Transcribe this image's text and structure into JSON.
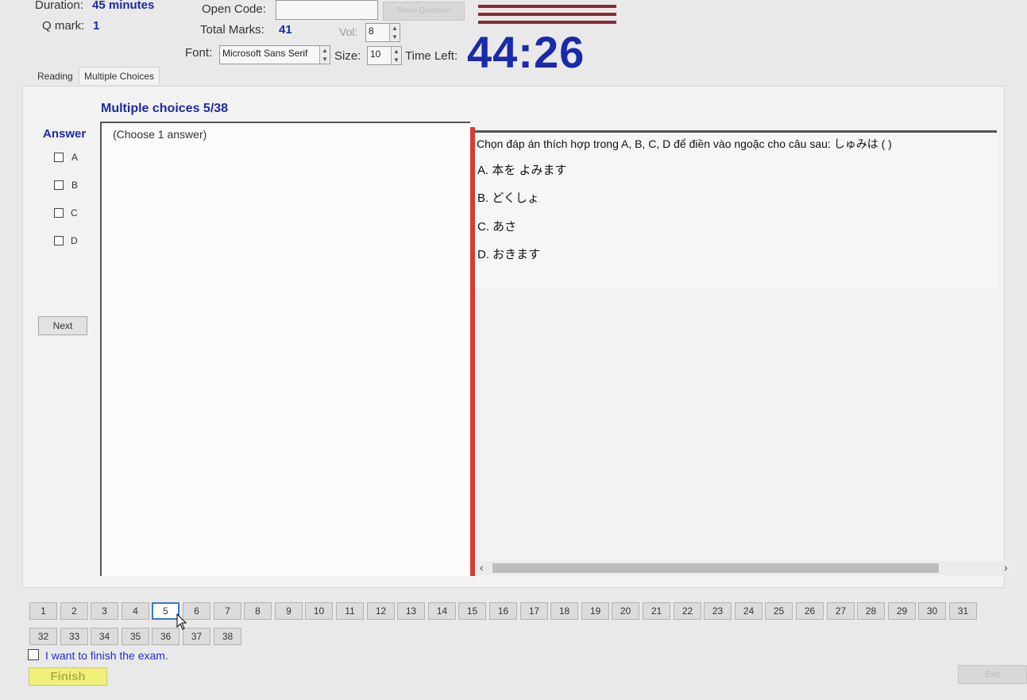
{
  "header": {
    "duration_label": "Duration:",
    "duration_value": "45 minutes",
    "qmark_label": "Q mark:",
    "qmark_value": "1",
    "open_code_label": "Open Code:",
    "open_code_value": "",
    "show_question_label": "Show Question",
    "total_marks_label": "Total Marks:",
    "total_marks_value": "41",
    "vol_label": "Vol:",
    "vol_value": "8",
    "font_label": "Font:",
    "font_value": "Microsoft Sans Serif",
    "size_label": "Size:",
    "size_value": "10",
    "time_left_label": "Time Left:",
    "time_left_value": "44:26"
  },
  "tabs": [
    {
      "label": "Reading",
      "active": false
    },
    {
      "label": "Multiple Choices",
      "active": true
    }
  ],
  "question_header": "Multiple choices 5/38",
  "answer": {
    "title": "Answer",
    "options": [
      "A",
      "B",
      "C",
      "D"
    ],
    "next_label": "Next"
  },
  "instruction": "(Choose 1 answer)",
  "question": {
    "prompt": "Chọn đáp án thích hợp trong A, B, C, D để điền vào ngoặc cho câu sau:  しゅみは (          )",
    "choices": [
      "A. 本を  よみます",
      "B. どくしょ",
      "C. あさ",
      "D. おきます"
    ]
  },
  "navigator": {
    "row1": [
      "1",
      "2",
      "3",
      "4",
      "5",
      "6",
      "7",
      "8",
      "9",
      "10",
      "11",
      "12",
      "13",
      "14",
      "15",
      "16",
      "17",
      "18",
      "19",
      "20",
      "21",
      "22",
      "23",
      "24",
      "25",
      "26",
      "27",
      "28",
      "29",
      "30",
      "31"
    ],
    "row2": [
      "32",
      "33",
      "34",
      "35",
      "36",
      "37",
      "38"
    ],
    "current": "5"
  },
  "footer": {
    "finish_checkbox_label": "I want to finish the exam.",
    "finish_label": "Finish",
    "exit_label": "Exit"
  },
  "colors": {
    "timer": "#1a2aa8",
    "accent_red": "#d93a32",
    "finish_yellow": "#f1f07a",
    "link_blue": "#2a2ad0"
  },
  "icons": {
    "mouse_cursor": "arrow-cursor-icon",
    "scroll_left": "chevron-left-icon",
    "scroll_right": "chevron-right-icon"
  }
}
